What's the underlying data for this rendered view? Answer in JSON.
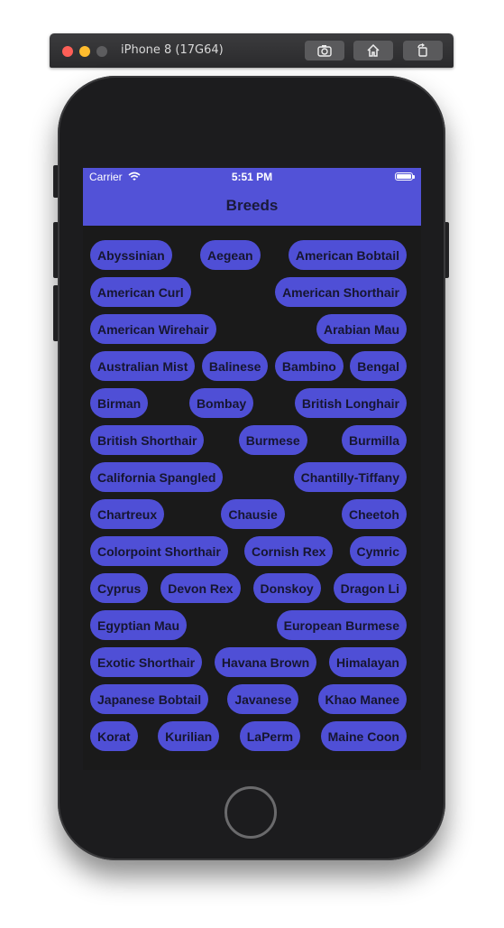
{
  "simulator": {
    "title": "iPhone 8 (17G64)",
    "buttons": [
      "screenshot-icon",
      "home-icon",
      "rotate-icon"
    ]
  },
  "status_bar": {
    "carrier": "Carrier",
    "time": "5:51 PM"
  },
  "nav": {
    "title": "Breeds"
  },
  "colors": {
    "nav_bg": "#5252d7",
    "chip_bg": "#4f4fd6",
    "screen_bg": "#1a1a1a"
  },
  "breeds": {
    "rows": [
      [
        "Abyssinian",
        "Aegean",
        "American Bobtail"
      ],
      [
        "American Curl",
        "American Shorthair"
      ],
      [
        "American Wirehair",
        "Arabian Mau"
      ],
      [
        "Australian Mist",
        "Balinese",
        "Bambino",
        "Bengal"
      ],
      [
        "Birman",
        "Bombay",
        "British Longhair"
      ],
      [
        "British Shorthair",
        "Burmese",
        "Burmilla"
      ],
      [
        "California Spangled",
        "Chantilly-Tiffany"
      ],
      [
        "Chartreux",
        "Chausie",
        "Cheetoh"
      ],
      [
        "Colorpoint Shorthair",
        "Cornish Rex",
        "Cymric"
      ],
      [
        "Cyprus",
        "Devon Rex",
        "Donskoy",
        "Dragon Li"
      ],
      [
        "Egyptian Mau",
        "European Burmese"
      ],
      [
        "Exotic Shorthair",
        "Havana Brown",
        "Himalayan"
      ],
      [
        "Japanese Bobtail",
        "Javanese",
        "Khao Manee"
      ],
      [
        "Korat",
        "Kurilian",
        "LaPerm",
        "Maine Coon"
      ]
    ]
  }
}
